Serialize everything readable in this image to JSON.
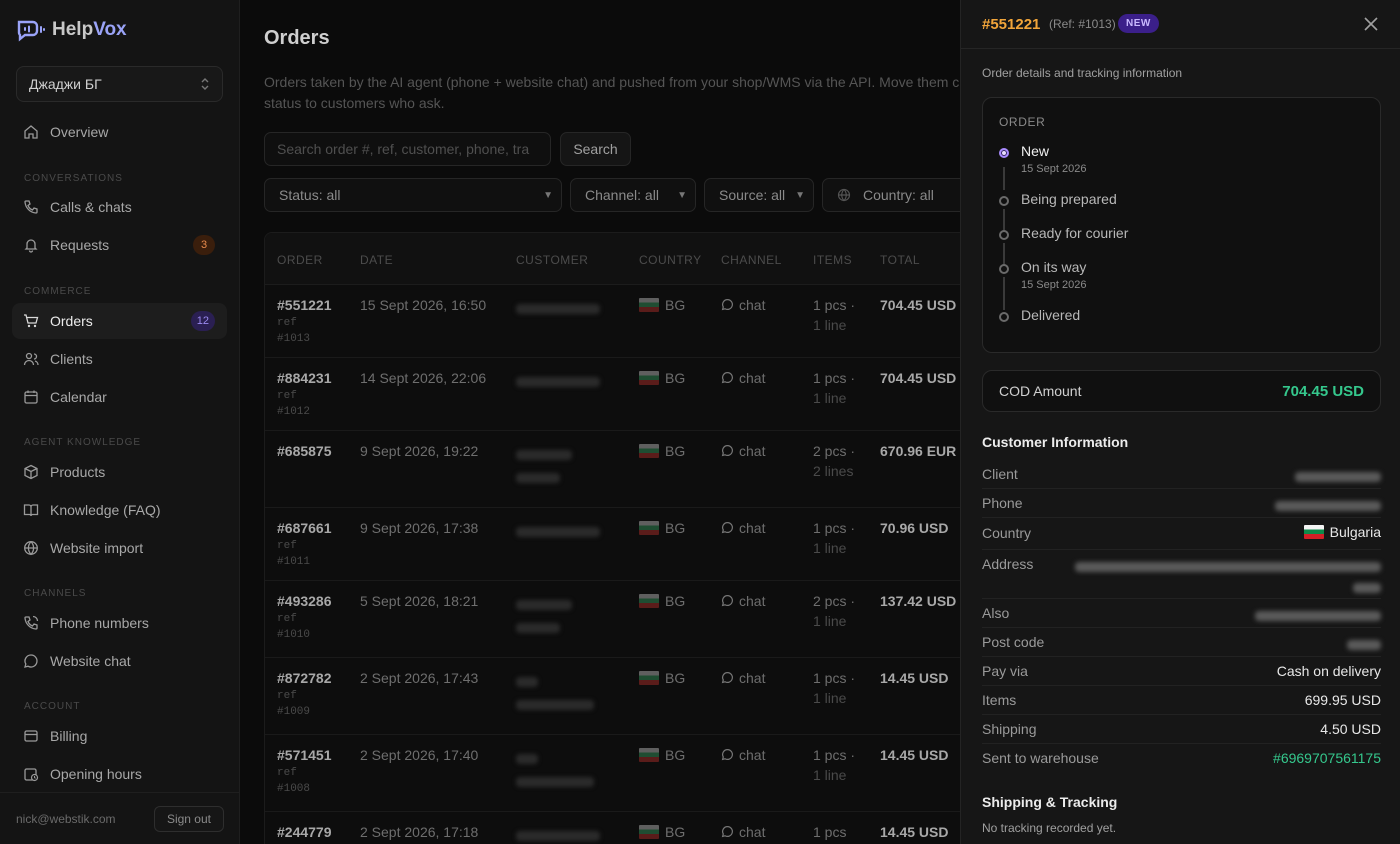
{
  "app": {
    "logo_help": "Help",
    "logo_vox": "Vox"
  },
  "workspace": {
    "name": "Джаджи БГ"
  },
  "sidebar": {
    "overview": "Overview",
    "sections": {
      "conversations": "CONVERSATIONS",
      "commerce": "COMMERCE",
      "agent_knowledge": "AGENT KNOWLEDGE",
      "channels": "CHANNELS",
      "account": "ACCOUNT"
    },
    "items": {
      "calls": "Calls & chats",
      "requests": "Requests",
      "requests_badge": "3",
      "orders": "Orders",
      "orders_badge": "12",
      "clients": "Clients",
      "calendar": "Calendar",
      "products": "Products",
      "knowledge": "Knowledge (FAQ)",
      "website_import": "Website import",
      "phone_numbers": "Phone numbers",
      "website_chat": "Website chat",
      "billing": "Billing",
      "opening_hours": "Opening hours"
    },
    "user_email": "nick@webstik.com",
    "sign_out": "Sign out"
  },
  "main": {
    "title": "Orders",
    "description": "Orders taken by the AI agent (phone + website chat) and pushed from your shop/WMS via the API. Move them current status to customers who ask.",
    "search_placeholder": "Search order #, ref, customer, phone, tra",
    "search_button": "Search",
    "filters": {
      "status": "Status: all",
      "channel": "Channel: all",
      "source": "Source: all",
      "country": "Country: all"
    },
    "columns": [
      "ORDER",
      "DATE",
      "CUSTOMER",
      "COUNTRY",
      "CHANNEL",
      "ITEMS",
      "TOTAL"
    ],
    "rows": [
      {
        "order": "#551221",
        "ref1": "ref",
        "ref2": "#1013",
        "date": "15 Sept 2026, 16:50",
        "country": "BG",
        "channel": "chat",
        "items": "1 pcs ·",
        "lines": "1 line",
        "total": "704.45 USD"
      },
      {
        "order": "#884231",
        "ref1": "ref",
        "ref2": "#1012",
        "date": "14 Sept 2026, 22:06",
        "country": "BG",
        "channel": "chat",
        "items": "1 pcs ·",
        "lines": "1 line",
        "total": "704.45 USD"
      },
      {
        "order": "#685875",
        "ref1": "",
        "ref2": "",
        "date": "9 Sept 2026, 19:22",
        "country": "BG",
        "channel": "chat",
        "items": "2 pcs ·",
        "lines": "2 lines",
        "total": "670.96 EUR"
      },
      {
        "order": "#687661",
        "ref1": "ref",
        "ref2": "#1011",
        "date": "9 Sept 2026, 17:38",
        "country": "BG",
        "channel": "chat",
        "items": "1 pcs ·",
        "lines": "1 line",
        "total": "70.96 USD"
      },
      {
        "order": "#493286",
        "ref1": "ref",
        "ref2": "#1010",
        "date": "5 Sept 2026, 18:21",
        "country": "BG",
        "channel": "chat",
        "items": "2 pcs ·",
        "lines": "1 line",
        "total": "137.42 USD"
      },
      {
        "order": "#872782",
        "ref1": "ref",
        "ref2": "#1009",
        "date": "2 Sept 2026, 17:43",
        "country": "BG",
        "channel": "chat",
        "items": "1 pcs ·",
        "lines": "1 line",
        "total": "14.45 USD"
      },
      {
        "order": "#571451",
        "ref1": "ref",
        "ref2": "#1008",
        "date": "2 Sept 2026, 17:40",
        "country": "BG",
        "channel": "chat",
        "items": "1 pcs ·",
        "lines": "1 line",
        "total": "14.45 USD"
      },
      {
        "order": "#244779",
        "ref1": "",
        "ref2": "",
        "date": "2 Sept 2026, 17:18",
        "country": "BG",
        "channel": "chat",
        "items": "1 pcs",
        "lines": "",
        "total": "14.45 USD"
      }
    ]
  },
  "drawer": {
    "order_no": "#551221",
    "ref": "(Ref: #1013)",
    "status_badge": "NEW",
    "subtitle": "Order details and tracking information",
    "order_card_title": "ORDER",
    "steps": [
      {
        "label": "New",
        "date": "15 Sept 2026"
      },
      {
        "label": "Being prepared",
        "date": ""
      },
      {
        "label": "Ready for courier",
        "date": ""
      },
      {
        "label": "On its way",
        "date": "15 Sept 2026"
      },
      {
        "label": "Delivered",
        "date": ""
      }
    ],
    "cod_label": "COD Amount",
    "cod_value": "704.45 USD",
    "customer_title": "Customer Information",
    "fields": {
      "client": "Client",
      "phone": "Phone",
      "country": "Country",
      "country_value": "Bulgaria",
      "address": "Address",
      "also": "Also",
      "post_code": "Post code",
      "pay_via": "Pay via",
      "pay_via_value": "Cash on delivery",
      "items": "Items",
      "items_value": "699.95 USD",
      "shipping": "Shipping",
      "shipping_value": "4.50 USD",
      "sent_to_warehouse": "Sent to warehouse",
      "sent_to_warehouse_value": "#6969707561175"
    },
    "tracking_title": "Shipping & Tracking",
    "tracking_empty": "No tracking recorded yet."
  },
  "colors": {
    "accent_purple": "#a98bff",
    "accent_green": "#35c88d",
    "accent_orange": "#f2a53a"
  }
}
